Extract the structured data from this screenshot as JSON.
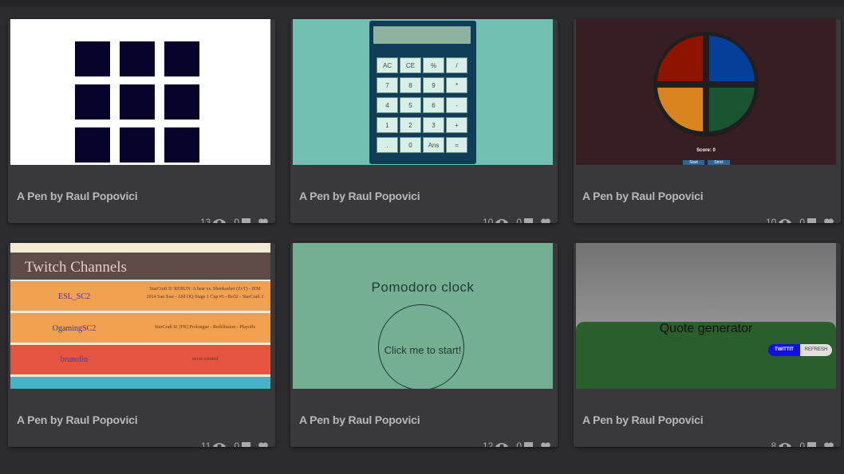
{
  "cards": [
    {
      "title": "A Pen by Raul Popovici",
      "views": "13",
      "comments": "0",
      "preview": {
        "kind": "grid"
      }
    },
    {
      "title": "A Pen by Raul Popovici",
      "views": "10",
      "comments": "0",
      "preview": {
        "kind": "calculator",
        "keys": [
          "AC",
          "CE",
          "%",
          "/",
          "7",
          "8",
          "9",
          "*",
          "4",
          "5",
          "6",
          "-",
          "1",
          "2",
          "3",
          "+",
          ".",
          "0",
          "Ans",
          "="
        ]
      }
    },
    {
      "title": "A Pen by Raul Popovici",
      "views": "10",
      "comments": "0",
      "preview": {
        "kind": "simon",
        "score_label": "Score: 0",
        "btn1": "Start",
        "btn2": "Strict"
      }
    },
    {
      "title": "A Pen by Raul Popovici",
      "views": "11",
      "comments": "0",
      "preview": {
        "kind": "twitch",
        "heading": "Twitch Channels",
        "rows": [
          {
            "name": "ESL_SC2",
            "desc": "StarCraft II: RERUN: A bear vs. Shenkasher (ZvT) - IEM 2014 San Jose - AM OQ Stage 1 Cup #1 - Ro32 - StarCraft 2"
          },
          {
            "name": "OgamingSC2",
            "desc": "StarCraft II: [FR] Prolongue - Rediffusion - Playoffs"
          },
          {
            "name": "brunofin",
            "desc": "never created"
          },
          {
            "name": "",
            "desc": ""
          }
        ]
      }
    },
    {
      "title": "A Pen by Raul Popovici",
      "views": "12",
      "comments": "0",
      "preview": {
        "kind": "pomodoro",
        "heading": "Pomodoro clock",
        "circle_text": "Click me to start!"
      }
    },
    {
      "title": "A Pen by Raul Popovici",
      "views": "8",
      "comments": "0",
      "preview": {
        "kind": "quote",
        "heading": "Quote generator",
        "btn_tweet": "TWITTIT",
        "btn_refresh": "REFRESH"
      }
    }
  ],
  "colors": {
    "background": "#2c2c2f",
    "card": "#39393c",
    "title": "#b8b8bc",
    "stats": "#a9a9ad"
  },
  "icons": {
    "views": "eye-icon",
    "comments": "comment-icon",
    "like": "heart-icon"
  }
}
